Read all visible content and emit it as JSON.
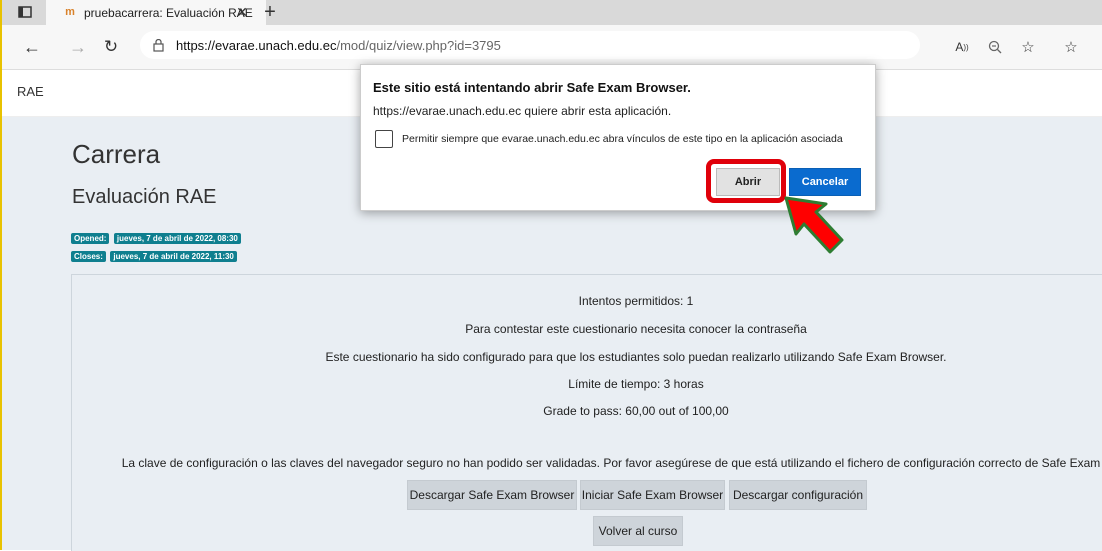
{
  "browser": {
    "tab_title": "pruebacarrera: Evaluación RAE",
    "url_host": "https://evarae.unach.edu.ec",
    "url_path": "/mod/quiz/view.php?id=3795"
  },
  "navbar": {
    "site_label": "RAE"
  },
  "page": {
    "heading": "Carrera",
    "quiz_title": "Evaluación RAE",
    "opened_label": "Opened:",
    "opened_value": "jueves, 7 de abril de 2022, 08:30",
    "closes_label": "Closes:",
    "closes_value": "jueves, 7 de abril de 2022, 11:30",
    "info": [
      "Intentos permitidos: 1",
      "Para contestar este cuestionario necesita conocer la contraseña",
      "Este cuestionario ha sido configurado para que los estudiantes solo puedan realizarlo utilizando Safe Exam Browser.",
      "Límite de tiempo: 3 horas",
      "Grade to pass: 60,00 out of 100,00"
    ],
    "warning": "La clave de configuración o las claves del navegador seguro no han podido ser validadas. Por favor asegúrese de que está utilizando el fichero de configuración correcto de Safe Exam Browser.",
    "buttons": {
      "download_seb": "Descargar Safe Exam Browser",
      "launch_seb": "Iniciar Safe Exam Browser",
      "download_config": "Descargar configuración",
      "back": "Volver al curso"
    }
  },
  "dialog": {
    "title": "Este sitio está intentando abrir Safe Exam Browser.",
    "subtitle": "https://evarae.unach.edu.ec quiere abrir esta aplicación.",
    "checkbox_label": "Permitir siempre que evarae.unach.edu.ec abra vínculos de este tipo en la aplicación asociada",
    "checkbox_checked": false,
    "open_label": "Abrir",
    "cancel_label": "Cancelar"
  },
  "colors": {
    "accent_blue": "#0a6bcf",
    "badge_teal": "#0f7f8f",
    "highlight_red": "#e0000a",
    "arrow_red": "#ff0000",
    "arrow_outline": "#2e7d32"
  }
}
